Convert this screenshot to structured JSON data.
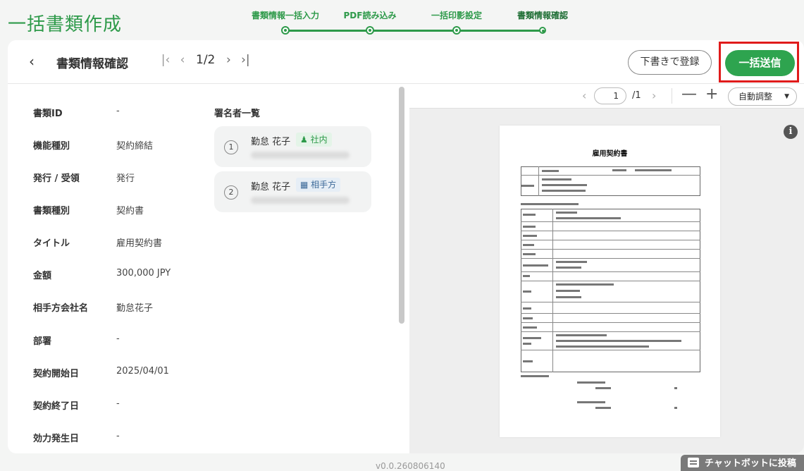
{
  "app": {
    "title": "一括書類作成"
  },
  "stepper": {
    "steps": [
      {
        "label": "書類情報一括入力"
      },
      {
        "label": "PDF読み込み"
      },
      {
        "label": "一括印影設定"
      },
      {
        "label": "書類情報確認"
      }
    ]
  },
  "toolbar": {
    "back_icon": "chevron-left-icon",
    "heading": "書類情報確認",
    "pager": {
      "current": "1",
      "total": "2",
      "text": "1/2"
    },
    "draft_label": "下書きで登録",
    "send_label": "一括送信"
  },
  "details": {
    "fields": [
      {
        "label": "書類ID",
        "value": "-"
      },
      {
        "label": "機能種別",
        "value": "契約締結"
      },
      {
        "label": "発行 / 受領",
        "value": "発行"
      },
      {
        "label": "書類種別",
        "value": "契約書"
      },
      {
        "label": "タイトル",
        "value": "雇用契約書"
      },
      {
        "label": "金額",
        "value": "300,000 JPY"
      },
      {
        "label": "相手方会社名",
        "value": "勤怠花子"
      },
      {
        "label": "部署",
        "value": "-"
      },
      {
        "label": "契約開始日",
        "value": "2025/04/01"
      },
      {
        "label": "契約終了日",
        "value": "-"
      },
      {
        "label": "効力発生日",
        "value": "-"
      }
    ],
    "signers_title": "署名者一覧",
    "signers": [
      {
        "number": "1",
        "name": "勤怠 花子",
        "tag": "社内",
        "tag_icon": "users-icon"
      },
      {
        "number": "2",
        "name": "勤怠 花子",
        "tag": "相手方",
        "tag_icon": "building-icon"
      }
    ]
  },
  "viewer": {
    "page_input": "1",
    "page_total": "/1",
    "zoom_label": "自動調整",
    "pdf_title": "雇用契約書"
  },
  "footer": {
    "version": "v0.0.260806140",
    "chatbot_label": "チャットボットに投稿"
  },
  "colors": {
    "accent": "#2e9a4a",
    "send_button": "#2ea44f",
    "highlight_frame": "#e01b1b"
  }
}
